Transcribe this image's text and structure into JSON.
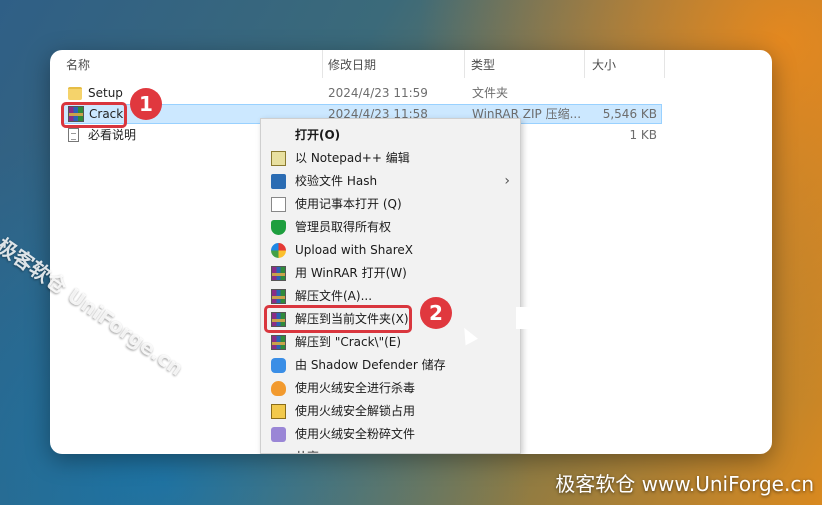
{
  "header": {
    "col_name": "名称",
    "col_date": "修改日期",
    "col_type": "类型",
    "col_size": "大小"
  },
  "files": [
    {
      "name": "Setup",
      "date": "2024/4/23 11:59",
      "type": "文件夹",
      "size": "",
      "icon": "folder-icon"
    },
    {
      "name": "Crack",
      "date": "2024/4/23 11:58",
      "type": "WinRAR ZIP 压缩...",
      "size": "5,546 KB",
      "icon": "winrar-archive-icon"
    },
    {
      "name": "必看说明",
      "date": "",
      "type": "",
      "size": "1 KB",
      "icon": "text-file-icon"
    }
  ],
  "badges": {
    "one": "1",
    "two": "2"
  },
  "menu": {
    "items": [
      {
        "label": "打开(O)",
        "icon": ""
      },
      {
        "label": "以 Notepad++ 编辑",
        "icon": "notepadpp-icon"
      },
      {
        "label": "校验文件 Hash",
        "icon": "hash-icon"
      },
      {
        "label": "使用记事本打开 (Q)",
        "icon": "notepad-icon"
      },
      {
        "label": "管理员取得所有权",
        "icon": "shield-icon"
      },
      {
        "label": "Upload with ShareX",
        "icon": "sharex-icon"
      },
      {
        "label": "用 WinRAR 打开(W)",
        "icon": "winrar-icon"
      },
      {
        "label": "解压文件(A)...",
        "icon": "winrar-icon"
      },
      {
        "label": "解压到当前文件夹(X)",
        "icon": "winrar-icon"
      },
      {
        "label": "解压到 \"Crack\\\"(E)",
        "icon": "winrar-icon"
      },
      {
        "label": "由 Shadow Defender 储存",
        "icon": "shadow-defender-icon"
      },
      {
        "label": "使用火绒安全进行杀毒",
        "icon": "huorong-fire-icon"
      },
      {
        "label": "使用火绒安全解锁占用",
        "icon": "huorong-unlock-icon"
      },
      {
        "label": "使用火绒安全粉碎文件",
        "icon": "huorong-shred-icon"
      },
      {
        "label": "共享",
        "icon": "share-icon"
      }
    ]
  },
  "watermark": {
    "diagonal": "极客软仓 UniForge.cn",
    "corner": "极客软仓 www.UniForge.cn"
  },
  "colors": {
    "accent_red": "#e0383e",
    "selection": "#cce8ff"
  }
}
